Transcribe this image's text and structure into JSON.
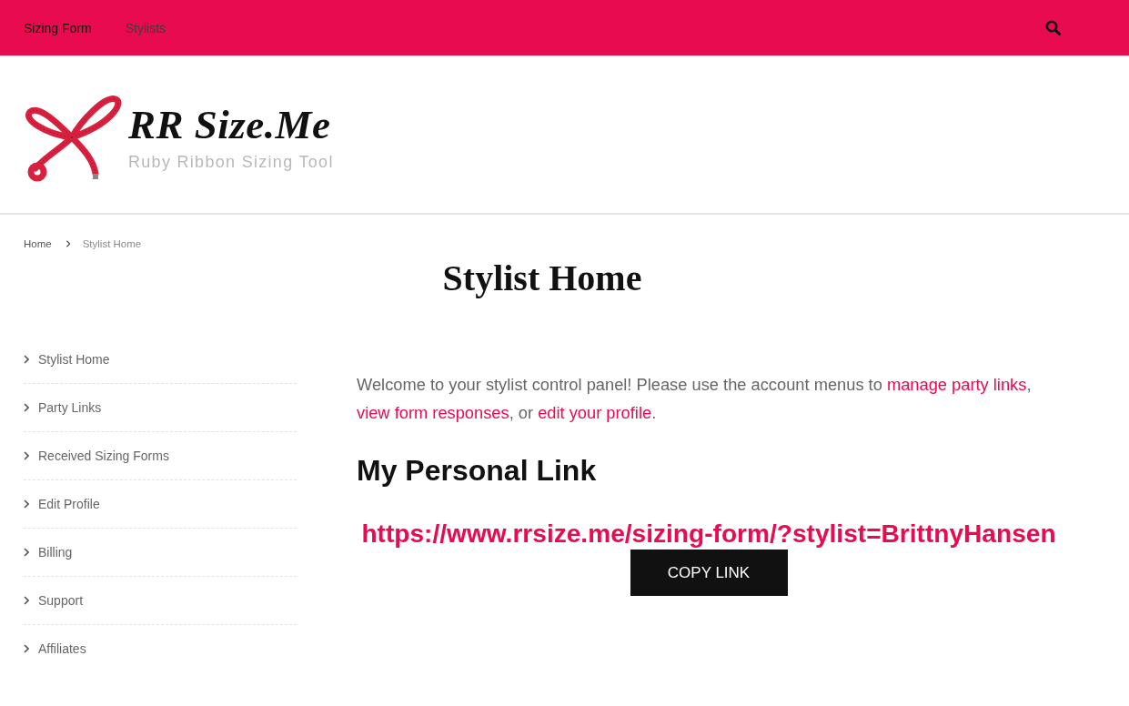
{
  "top_nav": {
    "items": [
      {
        "label": "Sizing Form",
        "selected": true
      },
      {
        "label": "Stylists",
        "selected": false
      }
    ]
  },
  "logo": {
    "title": "RR Size.Me",
    "tagline": "Ruby Ribbon Sizing Tool"
  },
  "breadcrumb": [
    "Home",
    "Stylist Home"
  ],
  "page_title": "Stylist Home",
  "sidebar": {
    "items": [
      "Stylist Home",
      "Party Links",
      "Received Sizing Forms",
      "Edit Profile",
      "Billing",
      "Support",
      "Affiliates"
    ]
  },
  "content": {
    "intro": [
      {
        "kind": "text",
        "text": "Welcome to your stylist control panel! Please use the account menus to "
      },
      {
        "kind": "link",
        "text": "manage party links"
      },
      {
        "kind": "text",
        "text": ", "
      },
      {
        "kind": "link",
        "text": "view form responses"
      },
      {
        "kind": "text",
        "text": ", or "
      },
      {
        "kind": "link",
        "text": "edit your profile"
      },
      {
        "kind": "text",
        "text": "."
      }
    ],
    "heading": "My Personal Link",
    "personal_link": "https://www.rrsize.me/sizing-form/?stylist=BrittnyHansen",
    "copy_button": "COPY LINK"
  }
}
